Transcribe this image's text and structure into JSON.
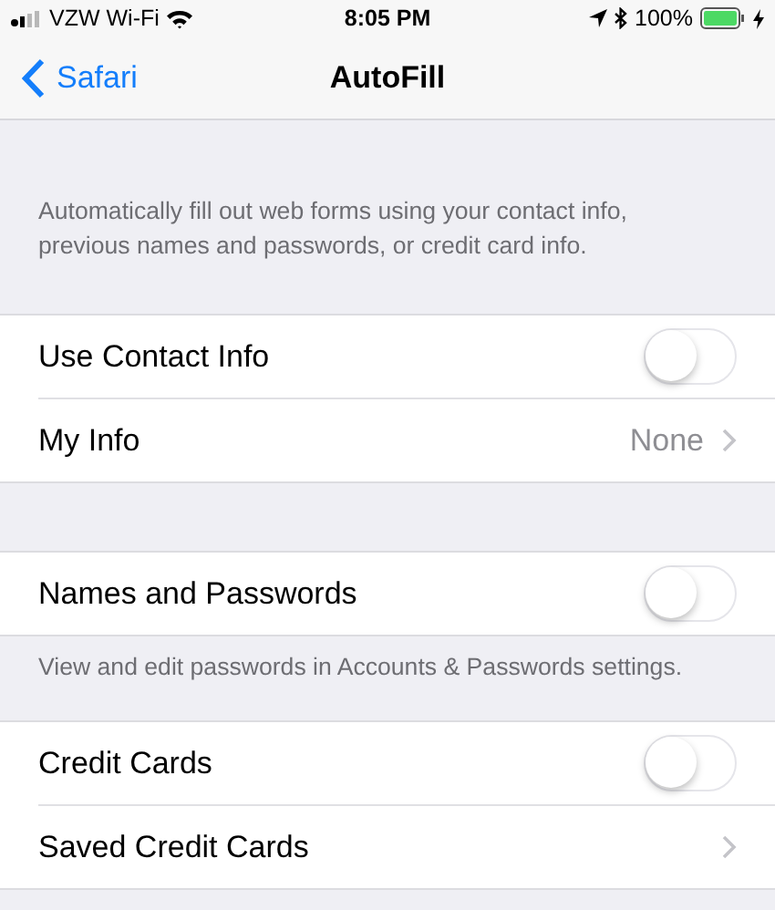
{
  "status_bar": {
    "carrier": "VZW Wi-Fi",
    "time": "8:05 PM",
    "battery": "100%"
  },
  "nav": {
    "back": "Safari",
    "title": "AutoFill"
  },
  "sections": [
    {
      "header": "Automatically fill out web forms using your contact info, previous names and passwords, or credit card info.",
      "rows": [
        {
          "kind": "toggle",
          "label": "Use Contact Info",
          "on": false
        },
        {
          "kind": "disclosure",
          "label": "My Info",
          "value": "None"
        }
      ]
    },
    {
      "rows": [
        {
          "kind": "toggle",
          "label": "Names and Passwords",
          "on": false
        }
      ],
      "footer": "View and edit passwords in Accounts & Passwords settings."
    },
    {
      "rows": [
        {
          "kind": "toggle",
          "label": "Credit Cards",
          "on": false
        },
        {
          "kind": "disclosure",
          "label": "Saved Credit Cards"
        }
      ]
    }
  ]
}
